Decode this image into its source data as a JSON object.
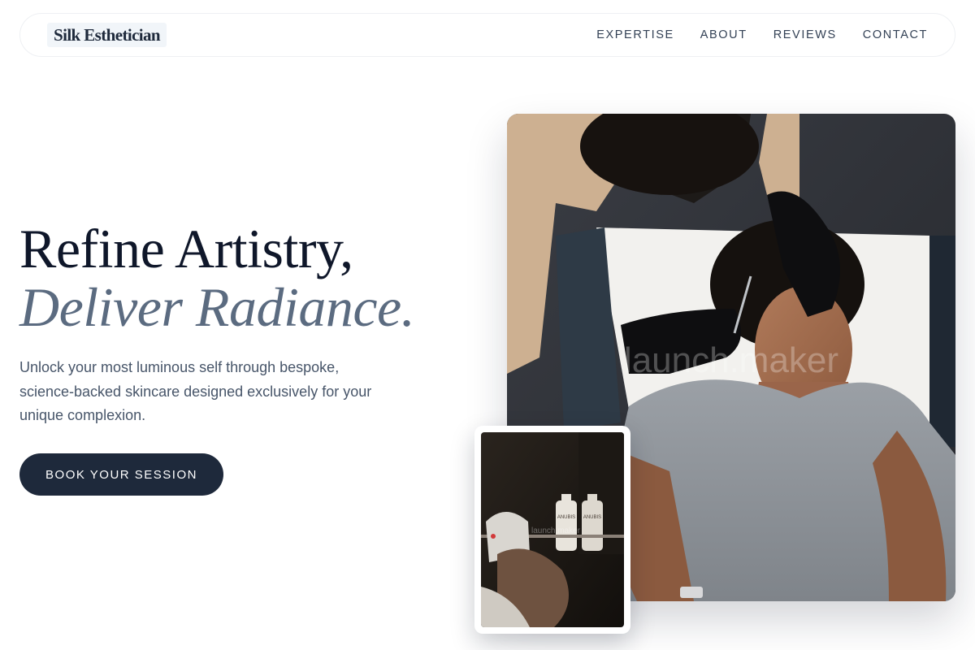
{
  "header": {
    "logo": "Silk Esthetician",
    "nav": [
      "EXPERTISE",
      "ABOUT",
      "REVIEWS",
      "CONTACT"
    ]
  },
  "hero": {
    "title_line1": "Refine Artistry,",
    "title_line2": "Deliver Radiance.",
    "description": "Unlock your most luminous self through bespoke, science-backed skincare designed exclusively for your unique complexion.",
    "cta_label": "BOOK YOUR SESSION"
  },
  "images": {
    "main_watermark": "launch.maker",
    "sub_watermark": "launch.maker",
    "bottle_label": "ANUBIS"
  },
  "colors": {
    "primary": "#1e293b",
    "accent": "#5b6b80",
    "text": "#0f172a",
    "muted": "#475569"
  }
}
